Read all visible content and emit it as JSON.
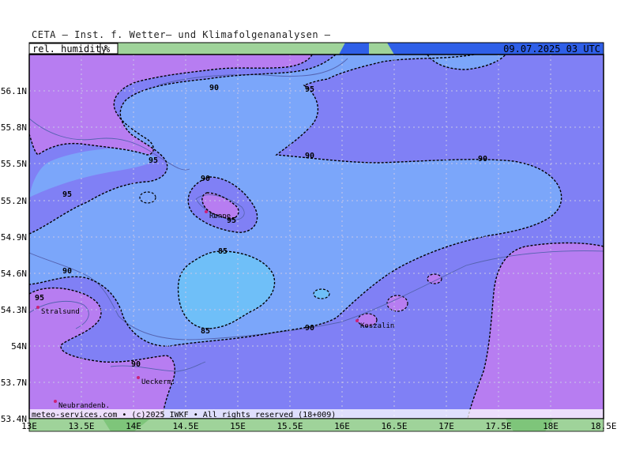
{
  "header": {
    "title": "CETA — Inst. f. Wetter— und Klimafolgenanalysen —",
    "parameter_label": "rel. humidity",
    "unit_label": "%",
    "datetime": "09.07.2025 03 UTC"
  },
  "footer": {
    "credit": "meteo-services.com • (c)2025 IWKF • All rights reserved (18+009)"
  },
  "axes": {
    "x_ticks": [
      "13E",
      "13.5E",
      "14E",
      "14.5E",
      "15E",
      "15.5E",
      "16E",
      "16.5E",
      "17E",
      "17.5E",
      "18E",
      "18.5E"
    ],
    "y_ticks": [
      "56.1N",
      "55.8N",
      "55.5N",
      "55.2N",
      "54.9N",
      "54.6N",
      "54.3N",
      "54N",
      "53.7N",
      "53.4N"
    ]
  },
  "cities": [
    {
      "name": "Rønne"
    },
    {
      "name": "Stralsund"
    },
    {
      "name": "Koszalin"
    },
    {
      "name": "Ueckerm."
    },
    {
      "name": "Neubrandenb."
    }
  ],
  "contours": {
    "labels": [
      "90",
      "95",
      "95",
      "90",
      "90",
      "95",
      "90",
      "90",
      "95",
      "85",
      "85",
      "90",
      "90",
      "95"
    ]
  },
  "colors": {
    "gt95": "#b77df1",
    "r90_95": "#8080f5",
    "r85_90": "#7ba6fa",
    "lt85": "#6fbff8",
    "coast": "#5563b0",
    "city": "#cc2277"
  }
}
